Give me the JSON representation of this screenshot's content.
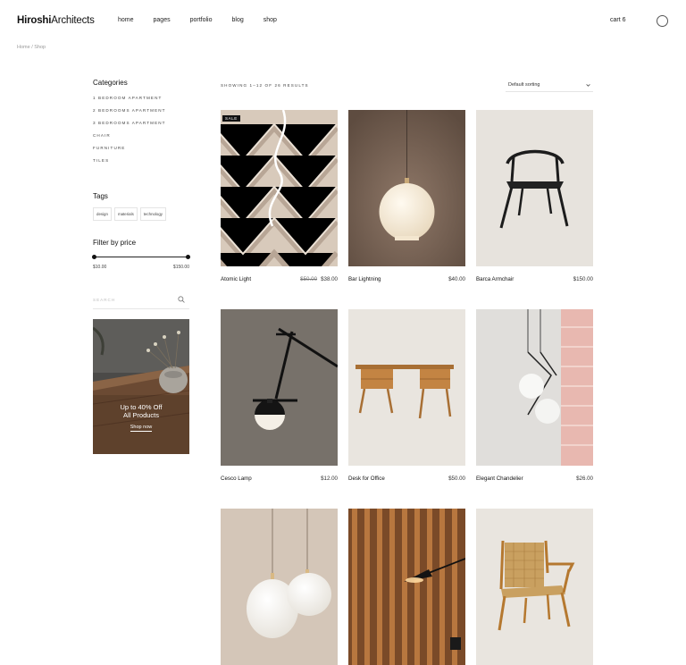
{
  "header": {
    "logo_bold": "Hiroshi",
    "logo_rest": "Architects",
    "nav": [
      "home",
      "pages",
      "portfolio",
      "blog",
      "shop"
    ],
    "cart_label": "cart 6"
  },
  "breadcrumb": "Home / Shop",
  "sidebar": {
    "categories_title": "Categories",
    "categories": [
      "1 bedroom apartment",
      "2 bedrooms apartment",
      "3 bedrooms apartment",
      "chair",
      "furniture",
      "tiles"
    ],
    "tags_title": "Tags",
    "tags": [
      "design",
      "materials",
      "technology"
    ],
    "price_title": "Filter by price",
    "price_min": "$10.00",
    "price_max": "$150.00",
    "search_placeholder": "SEARCH"
  },
  "promo": {
    "line1": "Up to 40% Off",
    "line2": "All Products",
    "link": "Shop now"
  },
  "toolbar": {
    "result_count": "SHOWING 1–12 OF 26 RESULTS",
    "sort_selected": "Default sorting"
  },
  "products": [
    {
      "name": "Atomic Light",
      "old_price": "$50.00",
      "price": "$38.00",
      "badge": "SALE"
    },
    {
      "name": "Bar Lightning",
      "price": "$40.00"
    },
    {
      "name": "Barca Armchair",
      "price": "$150.00"
    },
    {
      "name": "Cesco Lamp",
      "price": "$12.00"
    },
    {
      "name": "Desk for Office",
      "price": "$50.00"
    },
    {
      "name": "Elegant Chandelier",
      "price": "$26.00"
    },
    {
      "name": "",
      "price": ""
    },
    {
      "name": "",
      "price": ""
    },
    {
      "name": "",
      "price": ""
    }
  ]
}
